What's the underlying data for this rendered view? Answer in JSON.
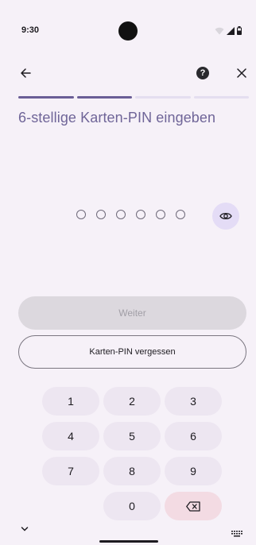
{
  "status_bar": {
    "time": "9:30",
    "icons": [
      "wifi-icon",
      "signal-icon",
      "battery-icon"
    ]
  },
  "app_bar": {
    "back_icon": "arrow-left-icon",
    "help_label": "?",
    "close_icon": "close-icon"
  },
  "progress": {
    "steps_total": 4,
    "steps_completed": 2
  },
  "title": "6-stellige Karten-PIN eingeben",
  "pin": {
    "length": 6,
    "filled": 0,
    "toggle_icon": "eye-icon"
  },
  "buttons": {
    "continue_label": "Weiter",
    "forgot_label": "Karten-PIN vergessen"
  },
  "keypad": {
    "keys": [
      "1",
      "2",
      "3",
      "4",
      "5",
      "6",
      "7",
      "8",
      "9",
      "0"
    ],
    "backspace_icon": "backspace-icon"
  },
  "nav_bar": {
    "icons": [
      "chevron-down-icon",
      "home-handle",
      "keyboard-icon"
    ]
  },
  "colors": {
    "background": "#f6f1f8",
    "accent": "#6a5e96",
    "title": "#6f6598",
    "eye_bg": "#e4dcf6",
    "key_bg": "#ede6f1",
    "backspace_bg": "#f3dbe3",
    "disabled_button": "#dcd8de"
  }
}
